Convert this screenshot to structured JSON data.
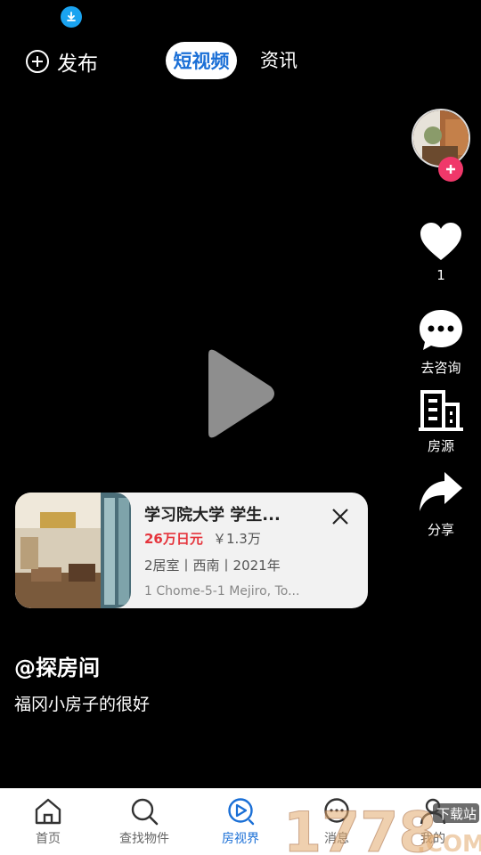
{
  "topbar": {
    "publish_label": "发布",
    "tabs": [
      {
        "label": "短视频",
        "active": true
      },
      {
        "label": "资讯",
        "active": false
      }
    ]
  },
  "side": {
    "like_count": "1",
    "consult_label": "去咨询",
    "source_label": "房源",
    "share_label": "分享"
  },
  "card": {
    "title": "学习院大学 学生...",
    "price": "26万日元",
    "price_cny": "￥1.3万",
    "spec": "2居室丨西南丨2021年",
    "address": "1 Chome-5-1 Mejiro, To..."
  },
  "post": {
    "author": "@探房间",
    "description": "福冈小房子的很好"
  },
  "nav": {
    "items": [
      {
        "label": "首页",
        "icon": "home-icon"
      },
      {
        "label": "查找物件",
        "icon": "search-icon"
      },
      {
        "label": "房视界",
        "icon": "play-circle-icon",
        "active": true
      },
      {
        "label": "消息",
        "icon": "chat-icon"
      },
      {
        "label": "我的",
        "icon": "user-icon"
      }
    ]
  },
  "watermark": {
    "text": "1778.COM",
    "tag": "下载站"
  },
  "colors": {
    "accent": "#1a6fd6",
    "price": "#e5343c",
    "follow": "#f0386a",
    "download": "#1aa3f0"
  }
}
